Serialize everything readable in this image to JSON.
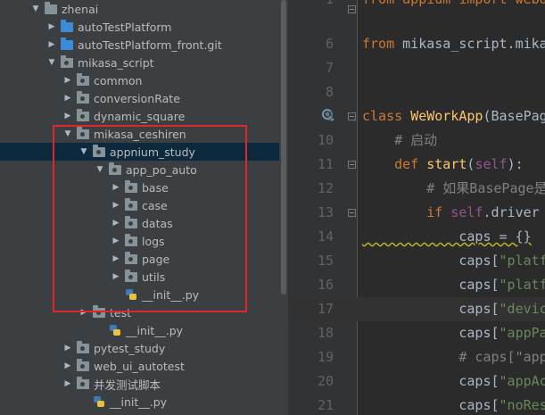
{
  "project_tree": [
    {
      "label": "zhenai",
      "arrow": "▼",
      "icon": "folder-gray"
    },
    {
      "label": "autoTestPlatform",
      "arrow": "▶",
      "icon": "folder-blue"
    },
    {
      "label": "autoTestPlatform_front.git",
      "arrow": "▶",
      "icon": "folder-blue"
    },
    {
      "label": "mikasa_script",
      "arrow": "▼",
      "icon": "package"
    },
    {
      "label": "common",
      "arrow": "▶",
      "icon": "package"
    },
    {
      "label": "conversionRate",
      "arrow": "▶",
      "icon": "package"
    },
    {
      "label": "dynamic_square",
      "arrow": "▶",
      "icon": "package"
    },
    {
      "label": "mikasa_ceshiren",
      "arrow": "▼",
      "icon": "package"
    },
    {
      "label": "appnium_study",
      "arrow": "▼",
      "icon": "package"
    },
    {
      "label": "app_po_auto",
      "arrow": "▼",
      "icon": "package"
    },
    {
      "label": "base",
      "arrow": "▶",
      "icon": "package"
    },
    {
      "label": "case",
      "arrow": "▶",
      "icon": "package"
    },
    {
      "label": "datas",
      "arrow": "▶",
      "icon": "package"
    },
    {
      "label": "logs",
      "arrow": "▶",
      "icon": "package"
    },
    {
      "label": "page",
      "arrow": "▶",
      "icon": "package"
    },
    {
      "label": "utils",
      "arrow": "▶",
      "icon": "package"
    },
    {
      "label": "__init__.py",
      "arrow": "",
      "icon": "python-file"
    },
    {
      "label": "test",
      "arrow": "▶",
      "icon": "package"
    },
    {
      "label": "__init__.py",
      "arrow": "",
      "icon": "python-file"
    },
    {
      "label": "pytest_study",
      "arrow": "▶",
      "icon": "package"
    },
    {
      "label": "web_ui_autotest",
      "arrow": "▶",
      "icon": "package"
    },
    {
      "label": "并发测试脚本",
      "arrow": "▶",
      "icon": "package"
    },
    {
      "label": "__init__.py",
      "arrow": "",
      "icon": "python-file"
    }
  ],
  "selected_item": "appnium_study",
  "editor": {
    "line_numbers": [
      "1",
      "6",
      "7",
      "8",
      "9",
      "10",
      "11",
      "12",
      "13",
      "14",
      "15",
      "16",
      "17",
      "18",
      "19",
      "20",
      "21"
    ],
    "lines": [
      [
        {
          "t": "from appium import webdriver",
          "c": "kw"
        }
      ],
      [
        {
          "t": "from ",
          "c": "kw"
        },
        {
          "t": "mikasa_script.mikasa_ceshiren",
          "c": "txt"
        }
      ],
      [],
      [],
      [
        {
          "t": "class ",
          "c": "kw"
        },
        {
          "t": "WeWorkApp",
          "c": "cls"
        },
        {
          "t": "(BasePage):",
          "c": "txt"
        }
      ],
      [
        {
          "t": "    # 启动",
          "c": "cmt"
        }
      ],
      [
        {
          "t": "    ",
          "c": "txt"
        },
        {
          "t": "def ",
          "c": "kw"
        },
        {
          "t": "start",
          "c": "cls"
        },
        {
          "t": "(",
          "c": "txt"
        },
        {
          "t": "self",
          "c": "self"
        },
        {
          "t": "):",
          "c": "txt"
        }
      ],
      [
        {
          "t": "        # 如果BasePage是空",
          "c": "cmt"
        }
      ],
      [
        {
          "t": "        ",
          "c": "txt"
        },
        {
          "t": "if ",
          "c": "kw"
        },
        {
          "t": "self",
          "c": "self"
        },
        {
          "t": ".driver == None:",
          "c": "txt"
        }
      ],
      [
        {
          "t": "            caps = {}",
          "c": "txt"
        }
      ],
      [
        {
          "t": "            caps[",
          "c": "txt"
        },
        {
          "t": "\"platformName\"",
          "c": "str"
        }
      ],
      [
        {
          "t": "            caps[",
          "c": "txt"
        },
        {
          "t": "\"platformVersion\"",
          "c": "str"
        }
      ],
      [
        {
          "t": "            caps[",
          "c": "txt"
        },
        {
          "t": "\"deviceName\"",
          "c": "str"
        }
      ],
      [
        {
          "t": "            caps[",
          "c": "txt"
        },
        {
          "t": "\"appPackage\"",
          "c": "str"
        }
      ],
      [
        {
          "t": "            # caps[\"appActivity\"]",
          "c": "cmt"
        }
      ],
      [
        {
          "t": "            caps[",
          "c": "txt"
        },
        {
          "t": "\"appActivity\"",
          "c": "str"
        }
      ],
      [
        {
          "t": "            caps[",
          "c": "txt"
        },
        {
          "t": "\"noReset\"",
          "c": "str"
        }
      ]
    ]
  },
  "colors": {
    "highlight_box": "#e0262b",
    "selection": "#0d293e",
    "keyword": "#cc7832",
    "string": "#6a8759"
  }
}
